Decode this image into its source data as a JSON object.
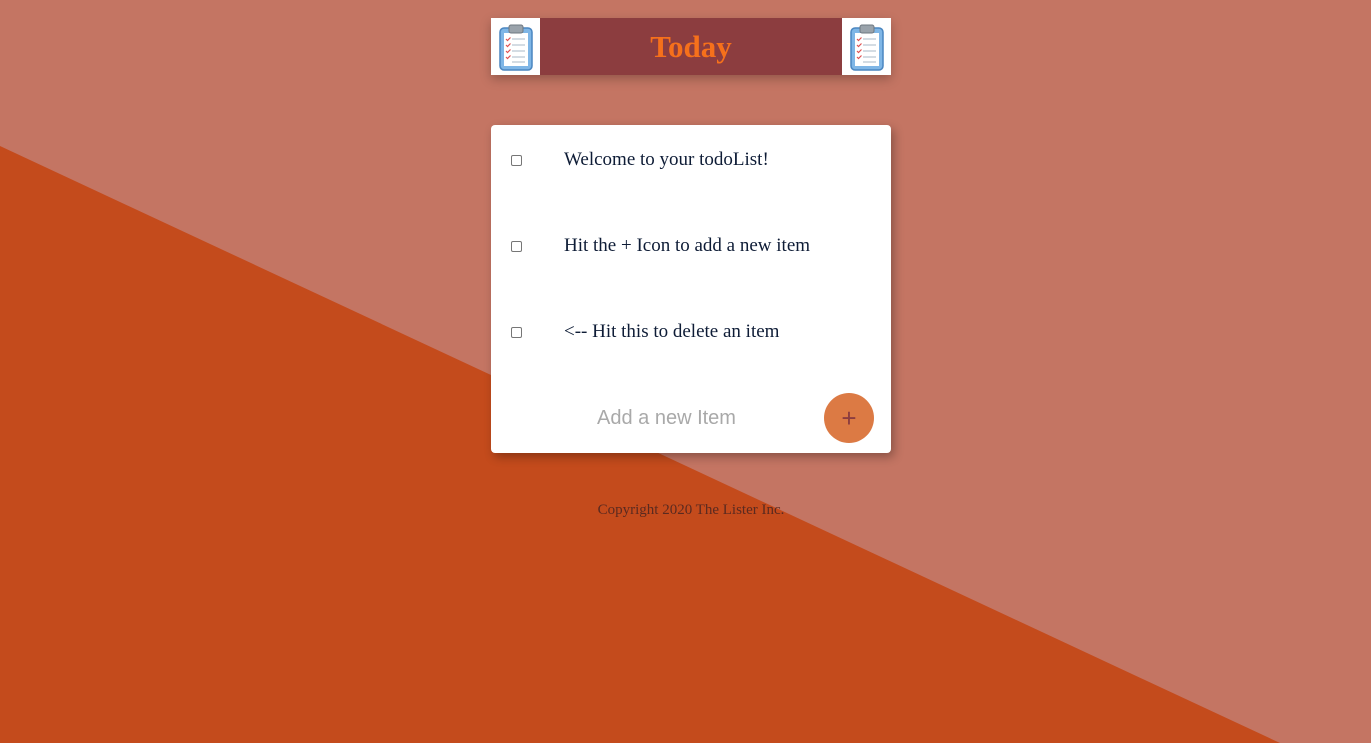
{
  "colors": {
    "page_background": "#c47563",
    "diagonal_band": "#c44b1c",
    "header_bar": "#8c3d3f",
    "title_text": "#f6701b",
    "add_button": "#dc7a44",
    "item_text": "#0e1c36"
  },
  "header": {
    "title": "Today",
    "left_icon": "clipboard-icon",
    "right_icon": "clipboard-icon"
  },
  "todo": {
    "items": [
      {
        "label": "Welcome to your todoList!",
        "checked": false
      },
      {
        "label": "Hit the + Icon to add a new item",
        "checked": false
      },
      {
        "label": "<-- Hit this to delete an item",
        "checked": false
      }
    ],
    "new_item": {
      "placeholder": "Add a new Item",
      "value": "",
      "add_label": "+"
    }
  },
  "footer": {
    "copyright": "Copyright 2020 The Lister Inc."
  }
}
